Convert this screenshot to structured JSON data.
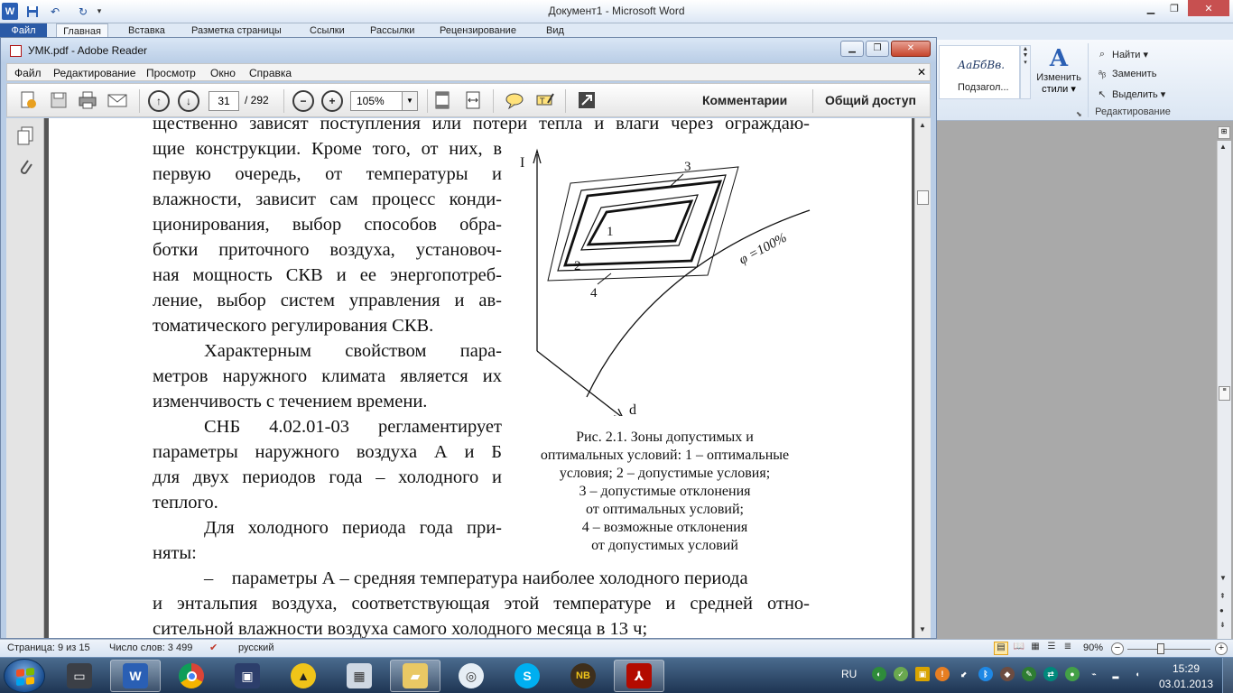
{
  "word": {
    "title": "Документ1 - Microsoft Word",
    "logo": "W",
    "tabs": {
      "file": "Файл",
      "home": "Главная",
      "insert": "Вставка",
      "layout": "Разметка страницы",
      "references": "Ссылки",
      "mailings": "Рассылки",
      "review": "Рецензирование",
      "view": "Вид"
    },
    "styles": {
      "sample": "АаБбВв.",
      "name": "Подзагол...",
      "change_styles": "Изменить",
      "change_styles_2": "стили ▾"
    },
    "editing": {
      "find": "Найти ▾",
      "replace": "Заменить",
      "select": "Выделить ▾",
      "group_label": "Редактирование"
    },
    "status": {
      "page": "Страница: 9 из 15",
      "words": "Число слов: 3 499",
      "language": "русский",
      "zoom": "90%",
      "zoom_fraction": 0.4
    }
  },
  "reader": {
    "title": "УМК.pdf - Adobe Reader",
    "menu": {
      "file": "Файл",
      "edit": "Редактирование",
      "view": "Просмотр",
      "window": "Окно",
      "help": "Справка"
    },
    "toolbar": {
      "page": "31",
      "total": "/ 292",
      "zoom": "105%",
      "comments": "Комментарии",
      "share": "Общий доступ"
    },
    "page": {
      "full_lines_top": [
        "щественно зависят поступления или потери тепла и влаги через ограждаю-"
      ],
      "col_lines": [
        "щие конструкции. Кроме того, от них, в",
        "первую очередь, от температуры и",
        "влажности, зависит сам процесс конди-",
        "ционирования, выбор способов обра-",
        "ботки приточного воздуха, установоч-",
        "ная мощность СКВ и ее энергопотреб-",
        "ление, выбор систем управления и ав-",
        "томатического регулирования СКВ.",
        "Характерным свойством пара-",
        "метров наружного климата является их",
        "изменчивость с течением времени.",
        "СНБ 4.02.01-03 регламентирует",
        "параметры наружного воздуха А и Б",
        "для двух периодов года – холодного и",
        "теплого.",
        "Для холодного периода года при-",
        "няты:"
      ],
      "full_lines_bottom": [
        "–    параметры А – средняя температура наиболее холодного периода",
        "и энтальпия воздуха, соответствующая этой температуре и средней отно-",
        "сительной влажности воздуха самого холодного месяца в 13 ч;"
      ],
      "figure": {
        "axis_y": "I",
        "axis_d": "d",
        "label_1": "1",
        "label_2": "2",
        "label_3": "3",
        "label_4": "4",
        "curve_label": "φ =100%",
        "caption": [
          "Рис. 2.1. Зоны допустимых и",
          "оптимальных условий: 1 – оптимальные",
          "условия; 2 – допустимые условия;",
          "3 – допустимые отклонения",
          "от оптимальных условий;",
          "4 – возможные отклонения",
          "от допустимых условий"
        ]
      }
    }
  },
  "taskbar": {
    "language": "RU",
    "time": "15:29",
    "date": "03.01.2013"
  },
  "colors": {
    "word_blue": "#2a5aa6",
    "reader_red": "#c6452c",
    "taskbar": "#1e3553"
  }
}
